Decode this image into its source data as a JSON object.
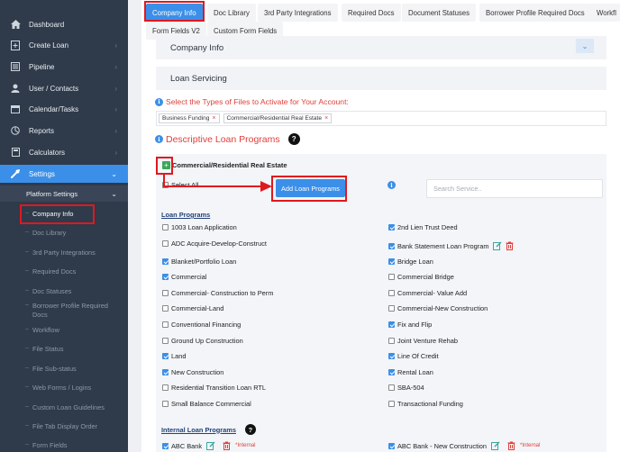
{
  "sidebar": {
    "items": [
      {
        "label": "Dashboard",
        "icon": "home-icon"
      },
      {
        "label": "Create Loan",
        "icon": "document-plus-icon"
      },
      {
        "label": "Pipeline",
        "icon": "list-icon"
      },
      {
        "label": "User / Contacts",
        "icon": "user-icon"
      },
      {
        "label": "Calendar/Tasks",
        "icon": "calendar-icon"
      },
      {
        "label": "Reports",
        "icon": "chart-icon"
      },
      {
        "label": "Calculators",
        "icon": "calculator-icon"
      },
      {
        "label": "Settings",
        "icon": "wrench-icon"
      }
    ],
    "platform_settings": "Platform Settings",
    "sub_items": [
      "Company Info",
      "Doc Library",
      "3rd Party Integrations",
      "Required Docs",
      "Doc Statuses",
      "Borrower Profile Required Docs",
      "Workflow",
      "File Status",
      "File Sub-status",
      "Web Forms / Logins",
      "Custom Loan Guidelines",
      "File Tab Display Order",
      "Form Fields"
    ]
  },
  "tabs": {
    "row1": [
      "Company Info",
      "Doc Library",
      "3rd Party Integrations",
      "Required Docs",
      "Document Statuses",
      "Borrower Profile Required Docs",
      "Workfl"
    ],
    "row2": [
      "Form Fields V2",
      "Custom Form Fields"
    ]
  },
  "panels": {
    "company_info": "Company Info",
    "loan_servicing": "Loan Servicing"
  },
  "file_types": {
    "heading": "Select the Types of Files to Activate for Your Account:",
    "chips": [
      "Business Funding",
      "Commercial/Residential Real Estate"
    ],
    "chip_remove": "×"
  },
  "descriptive": {
    "heading": "Descriptive Loan Programs",
    "help": "?",
    "section_title": "Commercial/Residential Real Estate",
    "select_all": "Select All",
    "add_button": "Add Loan Programs",
    "search_placeholder": "Search Service..",
    "loan_programs_label": "Loan Programs",
    "internal_label": "Internal Loan Programs",
    "internal_tag": "*Internal"
  },
  "programs_left": [
    {
      "label": "1003 Loan Application",
      "checked": false
    },
    {
      "label": "ADC Acquire-Develop-Construct",
      "checked": false
    },
    {
      "label": "Blanket/Portfolio Loan",
      "checked": true
    },
    {
      "label": "Commercial",
      "checked": true
    },
    {
      "label": "Commercial- Construction to Perm",
      "checked": false
    },
    {
      "label": "Commercial-Land",
      "checked": false
    },
    {
      "label": "Conventional Financing",
      "checked": false
    },
    {
      "label": "Ground Up Construction",
      "checked": false
    },
    {
      "label": "Land",
      "checked": true
    },
    {
      "label": "New Construction",
      "checked": true
    },
    {
      "label": "Residential Transition Loan RTL",
      "checked": false
    },
    {
      "label": "Small Balance Commercial",
      "checked": false
    }
  ],
  "programs_right": [
    {
      "label": "2nd Lien Trust Deed",
      "checked": true
    },
    {
      "label": "Bank Statement Loan Program",
      "checked": true
    },
    {
      "label": "Bridge Loan",
      "checked": true
    },
    {
      "label": "Commercial Bridge",
      "checked": false
    },
    {
      "label": "Commercial- Value Add",
      "checked": false
    },
    {
      "label": "Commercial-New Construction",
      "checked": false
    },
    {
      "label": "Fix and Flip",
      "checked": true
    },
    {
      "label": "Joint Venture Rehab",
      "checked": false
    },
    {
      "label": "Line Of Credit",
      "checked": true
    },
    {
      "label": "Rental Loan",
      "checked": true
    },
    {
      "label": "SBA-504",
      "checked": false
    },
    {
      "label": "Transactional Funding",
      "checked": false
    }
  ],
  "internal_programs": [
    {
      "label": "ABC Bank",
      "checked": true
    },
    {
      "label": "ABC Bank - New Construction",
      "checked": true
    }
  ],
  "colors": {
    "accent": "#3b8fe8",
    "sidebar": "#2f3a4a",
    "highlight": "#e0181f",
    "heading_red": "#e0403a"
  }
}
